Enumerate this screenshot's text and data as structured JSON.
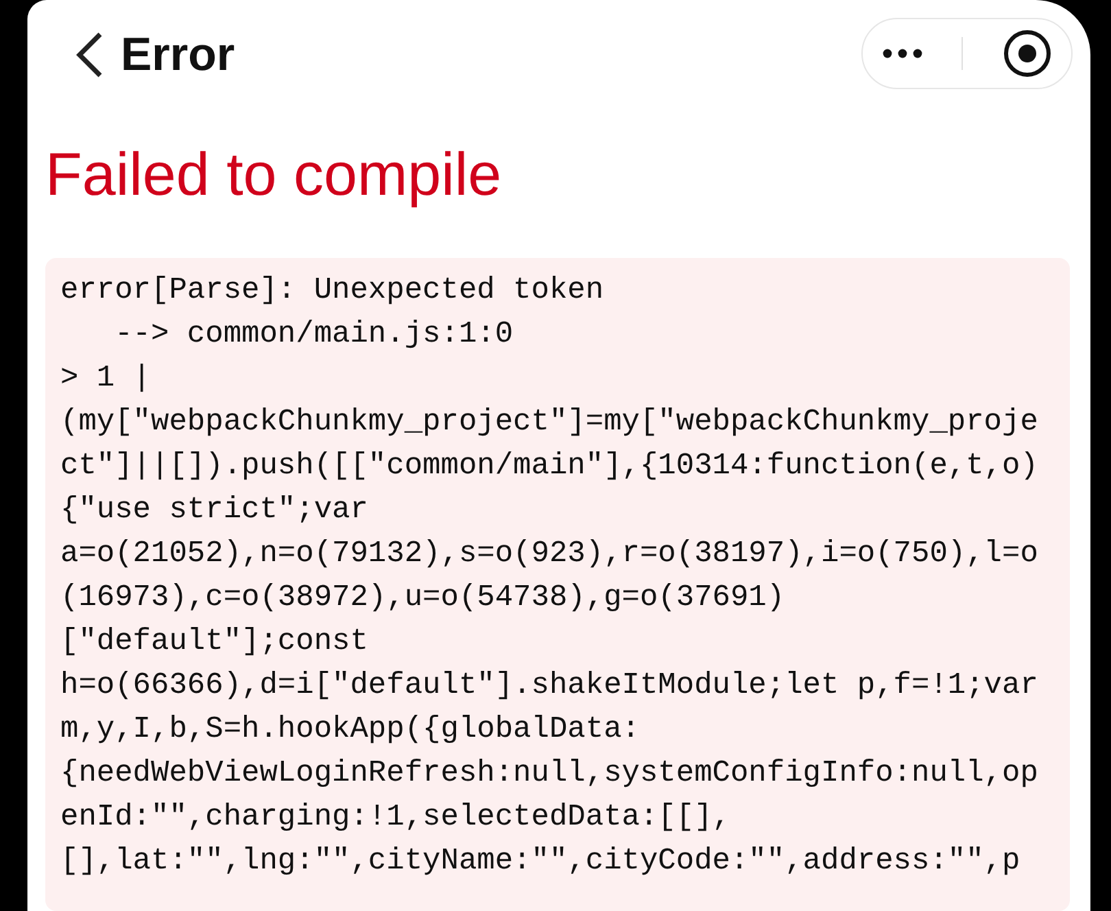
{
  "nav_bar": {
    "title": "Error"
  },
  "heading": "Failed to compile",
  "error_output": {
    "lines": [
      "error[Parse]: Unexpected token",
      "   --> common/main.js:1:0",
      "> 1 |",
      "(my[\"webpackChunkmy_project\"]=my[\"webpackChunkmy_proje",
      "ct\"]||[]).push([[\"common/main\"],{10314:function(e,t,o)",
      "{\"use strict\";var",
      "a=o(21052),n=o(79132),s=o(923),r=o(38197),i=o(750),l=o",
      "(16973),c=o(38972),u=o(54738),g=o(37691)",
      "[\"default\"];const",
      "h=o(66366),d=i[\"default\"].shakeItModule;let p,f=!1;var",
      "m,y,I,b,S=h.hookApp({globalData:",
      "{needWebViewLoginRefresh:null,systemConfigInfo:null,op",
      "enId:\"\",charging:!1,selectedData:[[],",
      "[],lat:\"\",lng:\"\",cityName:\"\",cityCode:\"\",address:\"\",p"
    ]
  }
}
